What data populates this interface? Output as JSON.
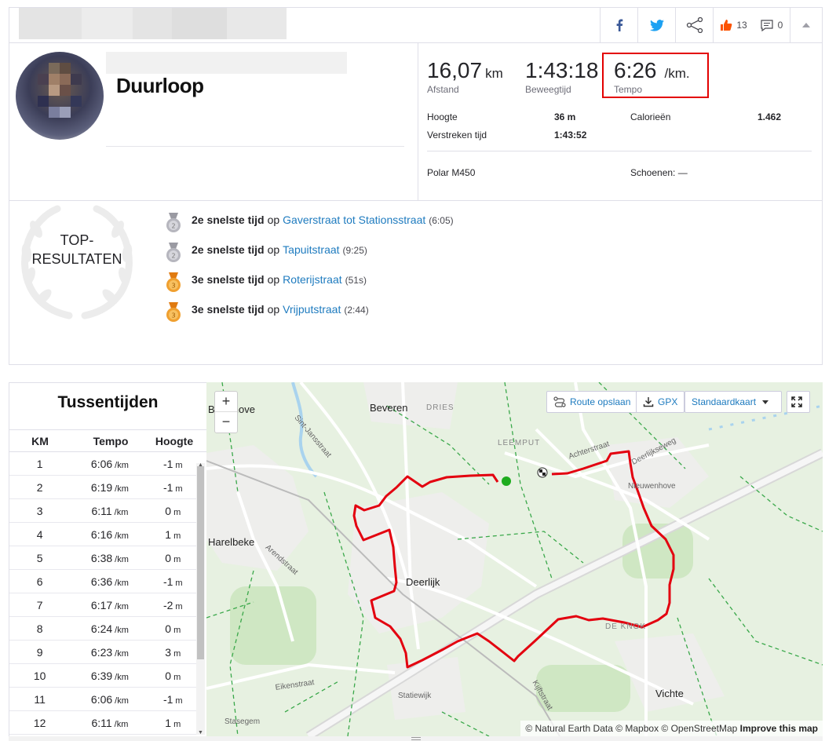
{
  "topbar": {
    "facebook_icon": "facebook-icon",
    "twitter_icon": "twitter-icon",
    "share_icon": "share-icon",
    "kudos_count": "13",
    "comment_count": "0"
  },
  "activity": {
    "title": "Duurloop",
    "stats": {
      "distance_value": "16,07",
      "distance_unit": "km",
      "distance_label": "Afstand",
      "moving_time_value": "1:43:18",
      "moving_time_label": "Beweegtijd",
      "pace_value": "6:26",
      "pace_unit": "/km.",
      "pace_label": "Tempo"
    },
    "details": {
      "elevation_label": "Hoogte",
      "elevation_value": "36 m",
      "calories_label": "Calorieën",
      "calories_value": "1.462",
      "elapsed_label": "Verstreken tijd",
      "elapsed_value": "1:43:52",
      "device": "Polar M450",
      "shoes_label": "Schoenen: —"
    }
  },
  "top_results": {
    "heading_line1": "TOP-",
    "heading_line2": "RESULTATEN",
    "items": [
      {
        "rank": "2e snelste tijd",
        "op": "op",
        "segment": "Gaverstraat tot Stationsstraat",
        "time": "(6:05)",
        "medal": "silver"
      },
      {
        "rank": "2e snelste tijd",
        "op": "op",
        "segment": "Tapuitstraat",
        "time": "(9:25)",
        "medal": "silver"
      },
      {
        "rank": "3e snelste tijd",
        "op": "op",
        "segment": "Roterijstraat",
        "time": "(51s)",
        "medal": "bronze"
      },
      {
        "rank": "3e snelste tijd",
        "op": "op",
        "segment": "Vrijputstraat",
        "time": "(2:44)",
        "medal": "bronze"
      }
    ]
  },
  "splits": {
    "title": "Tussentijden",
    "headers": {
      "km": "KM",
      "pace": "Tempo",
      "elev": "Hoogte"
    },
    "pace_unit": "/km",
    "elev_unit": "m",
    "rows": [
      {
        "km": "1",
        "pace": "6:06",
        "elev": "-1"
      },
      {
        "km": "2",
        "pace": "6:19",
        "elev": "-1"
      },
      {
        "km": "3",
        "pace": "6:11",
        "elev": "0"
      },
      {
        "km": "4",
        "pace": "6:16",
        "elev": "1"
      },
      {
        "km": "5",
        "pace": "6:38",
        "elev": "0"
      },
      {
        "km": "6",
        "pace": "6:36",
        "elev": "-1"
      },
      {
        "km": "7",
        "pace": "6:17",
        "elev": "-2"
      },
      {
        "km": "8",
        "pace": "6:24",
        "elev": "0"
      },
      {
        "km": "9",
        "pace": "6:23",
        "elev": "3"
      },
      {
        "km": "10",
        "pace": "6:39",
        "elev": "0"
      },
      {
        "km": "11",
        "pace": "6:06",
        "elev": "-1"
      },
      {
        "km": "12",
        "pace": "6:11",
        "elev": "1"
      }
    ]
  },
  "map": {
    "zoom_in": "+",
    "zoom_out": "−",
    "route_save": "Route opslaan",
    "gpx": "GPX",
    "map_type": "Standaardkaart",
    "attribution": "© Natural Earth Data © Mapbox © OpenStreetMap",
    "attribution_link": "Improve this map",
    "labels": {
      "bavikhove": "Bavikhove",
      "beveren": "Beveren",
      "dries": "DRIES",
      "leemput": "LEEMPUT",
      "harelbeke": "Harelbeke",
      "deerlijk": "Deerlijk",
      "nieuwenhove": "Nieuwenhove",
      "de_knok": "DE KNOK",
      "vichte": "Vichte",
      "stasegem": "Stasegem",
      "statiewijk": "Statiewijk",
      "sint_jansstraat": "Sint-Jansstraat",
      "arendstraat": "Arendstraat",
      "achterstraat": "Achterstraat",
      "deerlijkseweg": "Deerlijkseweg",
      "eikenstraat": "Eikenstraat",
      "kijftstraat": "Kijftstraat"
    },
    "route_color": "#e3000f"
  }
}
